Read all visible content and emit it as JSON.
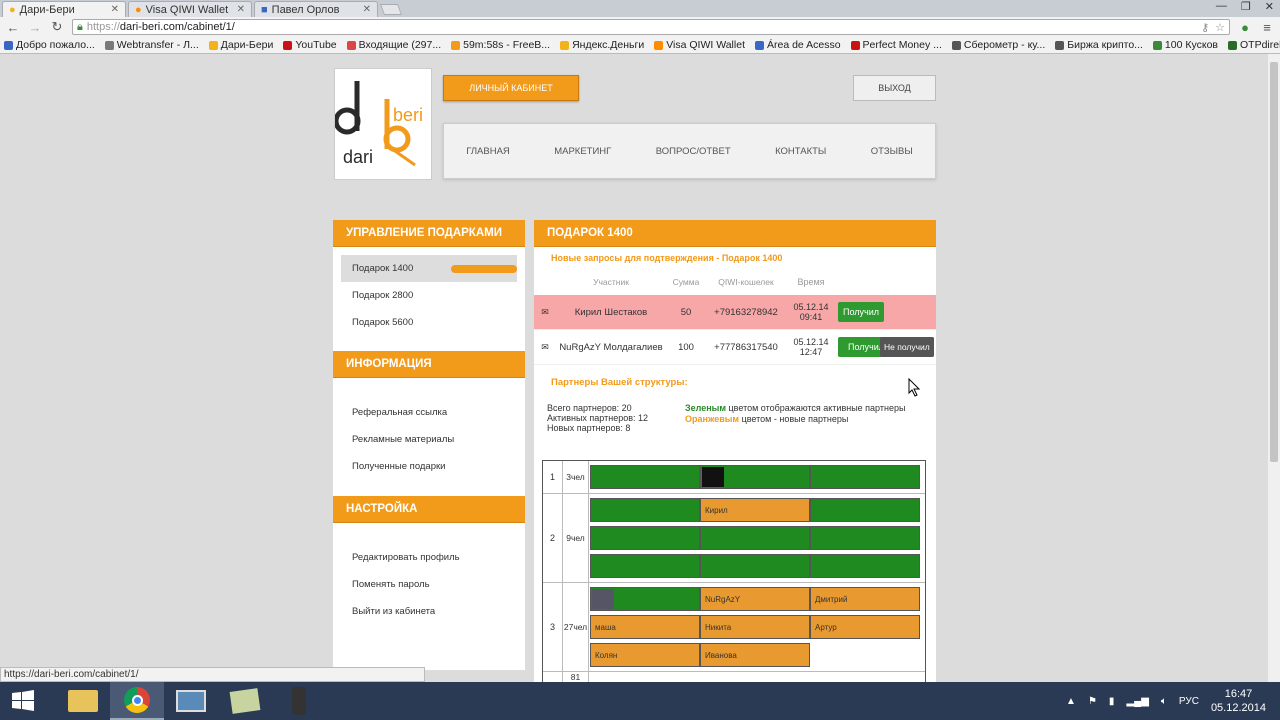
{
  "browser": {
    "tabs": [
      {
        "title": "Дари-Бери",
        "active": true
      },
      {
        "title": "Visa QIWI Wallet",
        "active": false
      },
      {
        "title": "Павел Орлов",
        "active": false
      }
    ],
    "url": "https://dari-beri.com/cabinet/1/",
    "url_host": "dari-beri.com/cabinet/1/",
    "url_scheme": "https://",
    "bookmarks": [
      {
        "label": "Добро пожало...",
        "color": "#3a66c4"
      },
      {
        "label": "Webtransfer - Л...",
        "color": "#7a7a7a"
      },
      {
        "label": "Дари-Бери",
        "color": "#f2b21a"
      },
      {
        "label": "YouTube",
        "color": "#cc1111"
      },
      {
        "label": "Входящие (297...",
        "color": "#d44"
      },
      {
        "label": "59m:58s - FreeB...",
        "color": "#f29a1a"
      },
      {
        "label": "Яндекс.Деньги",
        "color": "#f2b21a"
      },
      {
        "label": "Visa QIWI Wallet",
        "color": "#ff8c00"
      },
      {
        "label": "Área de Acesso",
        "color": "#3a66c4"
      },
      {
        "label": "Perfect Money ...",
        "color": "#cc1111"
      },
      {
        "label": "Сберометр - ку...",
        "color": "#555"
      },
      {
        "label": "Биржа крипто...",
        "color": "#555"
      },
      {
        "label": "100 Кусков",
        "color": "#3a8a3a"
      },
      {
        "label": "OTPdirekt Inter...",
        "color": "#2a6a2a"
      }
    ],
    "status_url": "https://dari-beri.com/cabinet/1/"
  },
  "site": {
    "logo": {
      "top": "beri",
      "bottom": "dari",
      "letter_d": "d",
      "letter_b": "b"
    },
    "cabinet_button": "ЛИЧНЫЙ КАБИНЕТ",
    "exit_button": "ВЫХОД",
    "nav": [
      "ГЛАВНАЯ",
      "МАРКЕТИНГ",
      "ВОПРОС/ОТВЕТ",
      "КОНТАКТЫ",
      "ОТЗЫВЫ"
    ]
  },
  "sidebar": {
    "gifts_title": "УПРАВЛЕНИЕ ПОДАРКАМИ",
    "gifts": [
      {
        "label": "Подарок 1400",
        "active": true
      },
      {
        "label": "Подарок 2800",
        "active": false
      },
      {
        "label": "Подарок 5600",
        "active": false
      }
    ],
    "info_title": "ИНФОРМАЦИЯ",
    "info": [
      "Реферальная ссылка",
      "Рекламные материалы",
      "Полученные подарки"
    ],
    "settings_title": "НАСТРОЙКА",
    "settings": [
      "Редактировать профиль",
      "Поменять пароль",
      "Выйти из кабинета"
    ]
  },
  "main": {
    "title": "ПОДАРОК 1400",
    "requests_title": "Новые запросы для подтверждения - Подарок 1400",
    "columns": [
      "Участник",
      "Сумма",
      "QIWI-кошелек",
      "Время"
    ],
    "requests": [
      {
        "icon": "✉",
        "name": "Кирил Шестаков",
        "sum": "50",
        "wallet": "+79163278942",
        "date": "05.12.14",
        "time": "09:41",
        "action": "Получил",
        "highlight": true
      },
      {
        "icon": "✉",
        "name": "NuRgAzY Молдагалиев",
        "sum": "100",
        "wallet": "+77786317540",
        "date": "05.12.14",
        "time": "12:47",
        "action": "Получил",
        "alt_action": "Не получил",
        "highlight": false
      }
    ],
    "partners_title": "Партнеры Вашей структуры:",
    "stats": {
      "total": "Всего партнеров: 20",
      "active": "Активных партнеров: 12",
      "new": "Новых партнеров: 8",
      "green_word": "Зеленым",
      "green_rest": " цветом отображаются активные партнеры",
      "orange_word": "Оранжевым",
      "orange_rest": " цветом - новые партнеры"
    },
    "levels": [
      {
        "level": "1",
        "count": "3",
        "unit": "чел",
        "cells": [
          {
            "label": "",
            "status": "active"
          },
          {
            "label": "",
            "status": "active",
            "avatar": true
          },
          {
            "label": "",
            "status": "active"
          }
        ]
      },
      {
        "level": "2",
        "count": "9",
        "unit": "чел",
        "cells": [
          {
            "label": "",
            "status": "active"
          },
          {
            "label": "Кирил",
            "status": "new"
          },
          {
            "label": "",
            "status": "active"
          },
          {
            "label": "",
            "status": "active"
          },
          {
            "label": "",
            "status": "active"
          },
          {
            "label": "",
            "status": "active"
          },
          {
            "label": "",
            "status": "active"
          },
          {
            "label": "",
            "status": "active"
          },
          {
            "label": "",
            "status": "active"
          }
        ]
      },
      {
        "level": "3",
        "count": "27",
        "unit": "чел",
        "cells": [
          {
            "label": "",
            "status": "active",
            "avatar": true
          },
          {
            "label": "NuRgAzY",
            "status": "new"
          },
          {
            "label": "Дмитрий",
            "status": "new"
          },
          {
            "label": "маша",
            "status": "new"
          },
          {
            "label": "Никита",
            "status": "new"
          },
          {
            "label": "Артур",
            "status": "new"
          },
          {
            "label": "Колян",
            "status": "new"
          },
          {
            "label": "Иванова",
            "status": "new"
          }
        ]
      }
    ],
    "next_level": "81"
  },
  "taskbar": {
    "lang": "РУС",
    "time": "16:47",
    "date": "05.12.2014"
  },
  "colors": {
    "accent": "#f29a1a",
    "active_green": "#1f8a1f",
    "new_orange": "#e89a30",
    "highlight_pink": "#f7a7a7"
  }
}
